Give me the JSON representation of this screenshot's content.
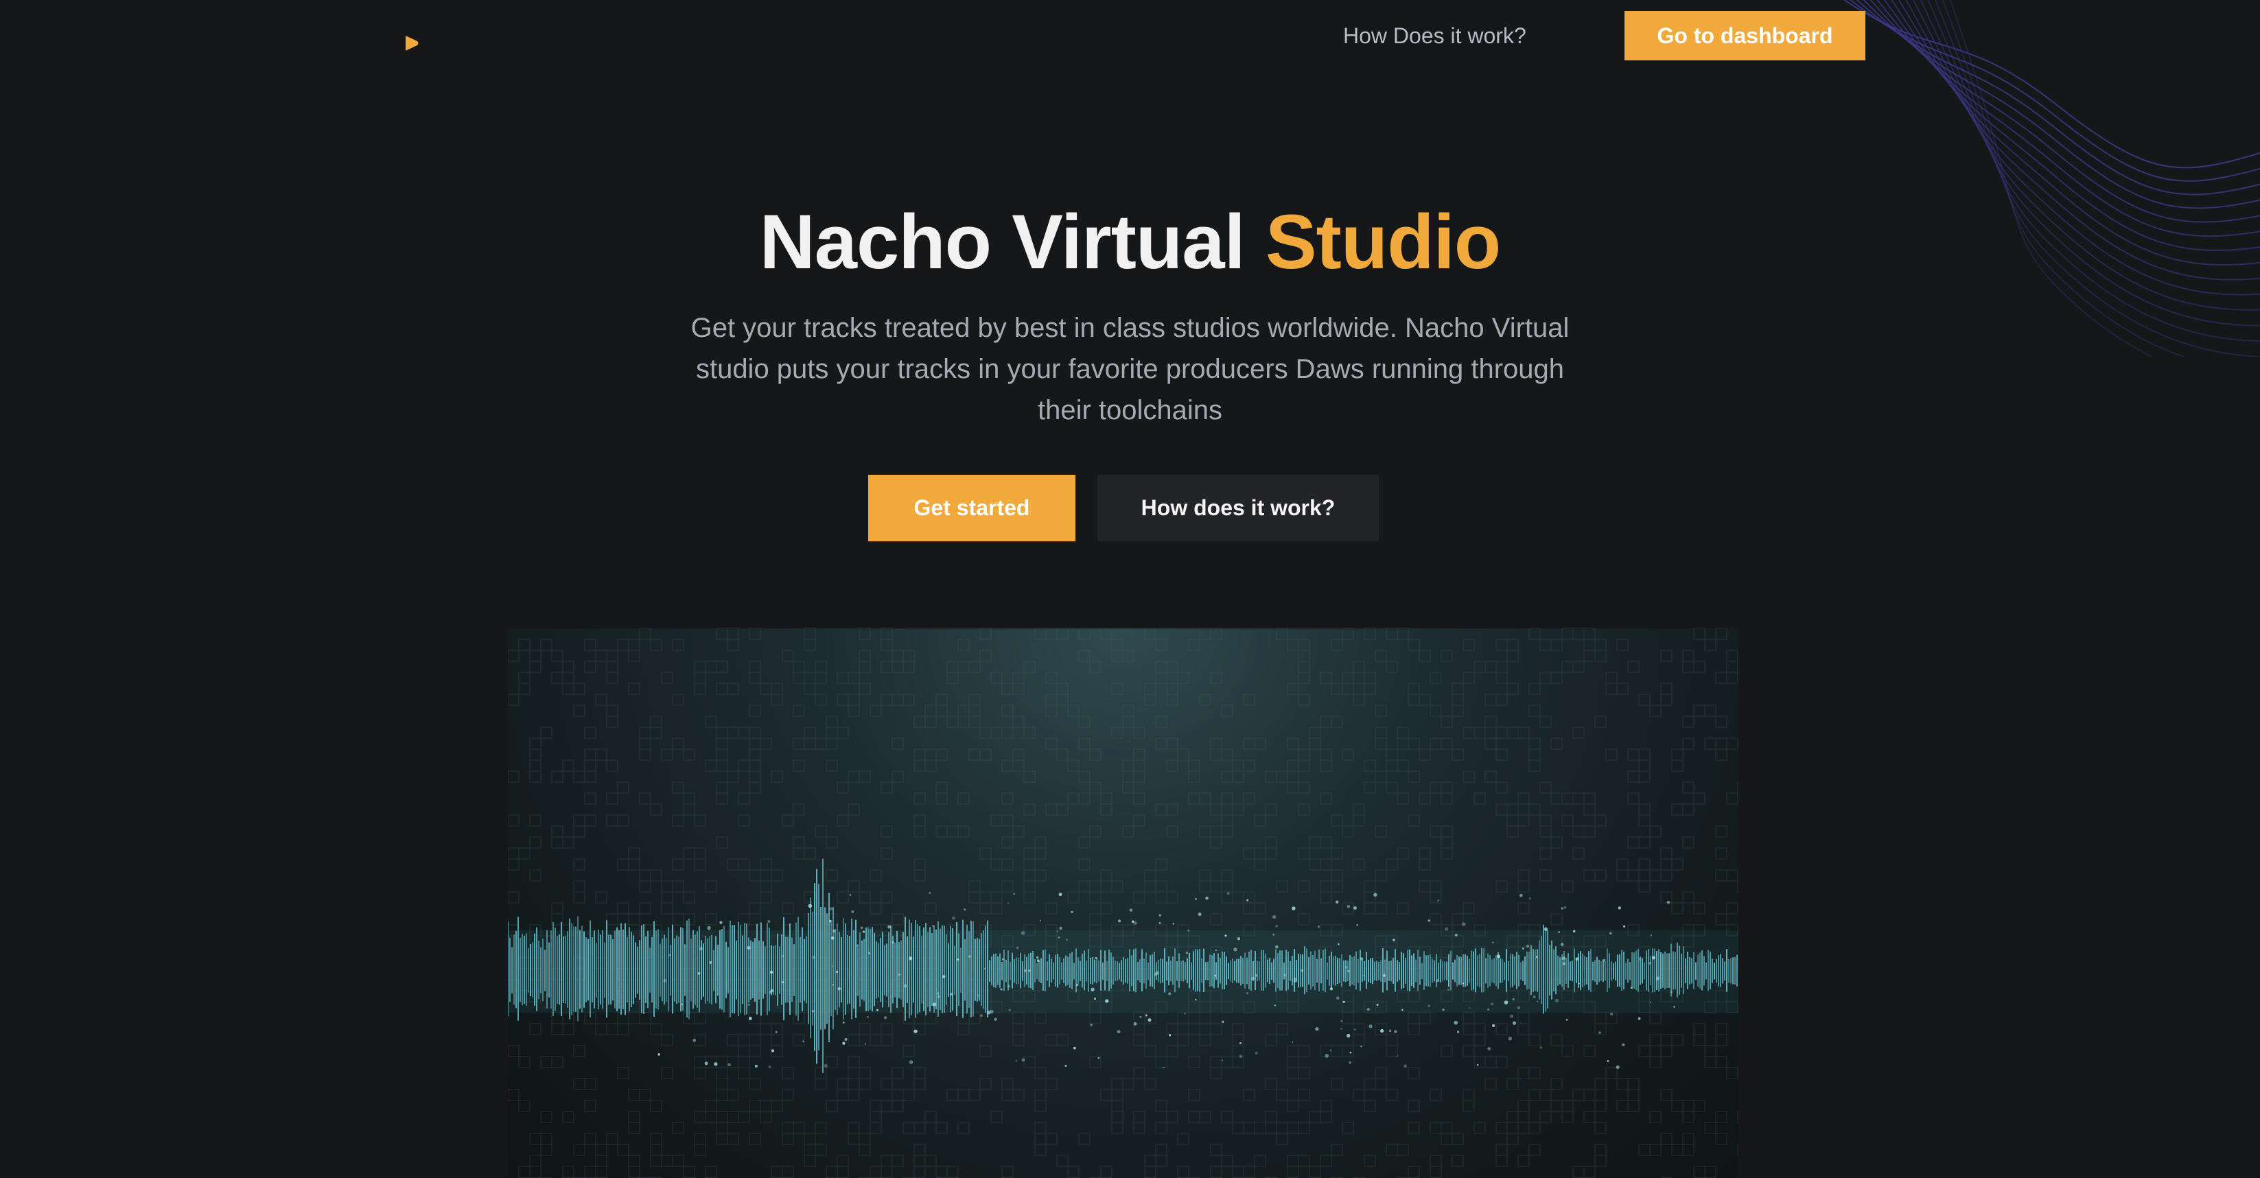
{
  "nav": {
    "link_label": "How Does it work?",
    "cta_label": "Go to dashboard",
    "logo_icon": "play-triangle-icon"
  },
  "hero": {
    "title_main": "Nacho Virtual",
    "title_accent": "Studio",
    "subtitle": "Get your tracks treated by best in class studios worldwide. Nacho Virtual studio puts your tracks in your favorite producers Daws running through their toolchains",
    "primary_label": "Get started",
    "secondary_label": "How does it work?"
  },
  "media": {
    "image_subject": "audio-waveform-image"
  },
  "colors": {
    "background": "#161719",
    "accent": "#f2a93b",
    "secondary_button": "#232427",
    "wave_lines": "#3a3a8a",
    "waveform": "#5fb8c4"
  }
}
